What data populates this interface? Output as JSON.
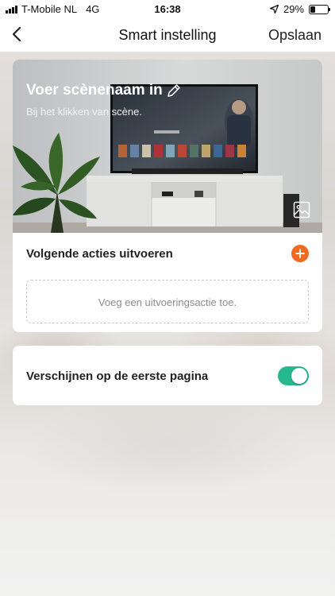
{
  "status_bar": {
    "carrier": "T-Mobile NL",
    "network": "4G",
    "time": "16:38",
    "battery_percent": "29%",
    "battery_level": 0.29,
    "icons": [
      "signal-icon",
      "location-arrow-icon",
      "battery-icon"
    ]
  },
  "nav": {
    "title": "Smart instelling",
    "save_label": "Opslaan",
    "back_icon": "chevron-left-icon"
  },
  "scene": {
    "name_placeholder": "Voer scènenaam in",
    "subtitle": "Bij het klikken van  scène.",
    "edit_icon": "pencil-icon",
    "image_icon": "image-icon",
    "background": "living room with television"
  },
  "actions": {
    "title": "Volgende acties uitvoeren",
    "add_icon": "plus-circle-icon",
    "placeholder": "Voeg een uitvoeringsactie toe."
  },
  "home_page": {
    "label": "Verschijnen op de eerste pagina",
    "enabled": true
  },
  "colors": {
    "accent_orange": "#f06a22",
    "toggle_on": "#26b98e"
  }
}
